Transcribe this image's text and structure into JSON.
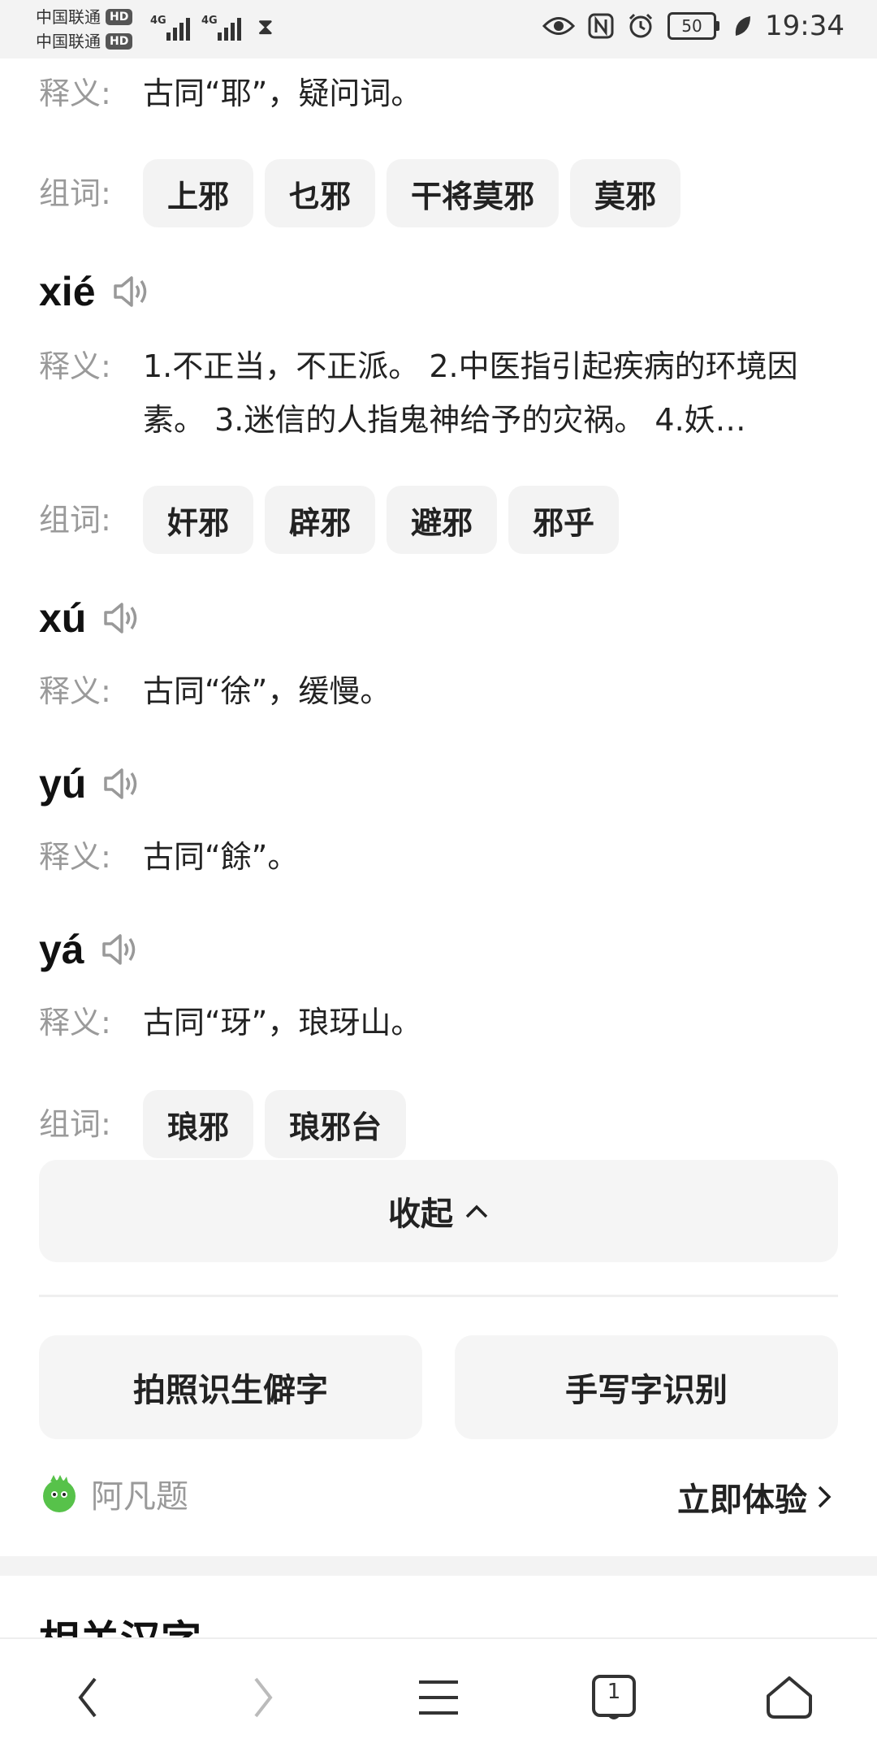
{
  "status_bar": {
    "carrier_1": "中国联通",
    "carrier_2": "中国联通",
    "hd_badge": "HD",
    "network_1": "4G",
    "network_2": "4G",
    "battery": "50",
    "time": "19:34",
    "icons": [
      "hourglass-icon",
      "eye-icon",
      "nfc-icon",
      "alarm-icon",
      "battery-icon",
      "leaf-icon"
    ]
  },
  "entries": [
    {
      "meaning_label": "释义:",
      "meaning": "古同“耶”，疑问词。",
      "words_label": "组词:",
      "words": [
        "上邪",
        "乜邪",
        "干将莫邪",
        "莫邪"
      ]
    },
    {
      "pinyin": "xié",
      "meaning_label": "释义:",
      "meaning": "1.不正当，不正派。 2.中医指引起疾病的环境因素。 3.迷信的人指鬼神给予的灾祸。 4.妖…",
      "words_label": "组词:",
      "words": [
        "奸邪",
        "辟邪",
        "避邪",
        "邪乎"
      ]
    },
    {
      "pinyin": "xú",
      "meaning_label": "释义:",
      "meaning": "古同“徐”，缓慢。"
    },
    {
      "pinyin": "yú",
      "meaning_label": "释义:",
      "meaning": "古同“餘”。"
    },
    {
      "pinyin": "yá",
      "meaning_label": "释义:",
      "meaning": "古同“玡”，琅玡山。",
      "words_label": "组词:",
      "words": [
        "琅邪",
        "琅邪台"
      ]
    }
  ],
  "collapse_label": "收起",
  "tools": {
    "photo_label": "拍照识生僻字",
    "handwrite_label": "手写字识别"
  },
  "promo": {
    "name": "阿凡题",
    "action": "立即体验"
  },
  "related_title": "相关汉字",
  "bottom_nav": [
    "back-icon",
    "forward-icon",
    "menu-icon",
    "tabs-icon",
    "home-icon"
  ],
  "tab_count": "1"
}
